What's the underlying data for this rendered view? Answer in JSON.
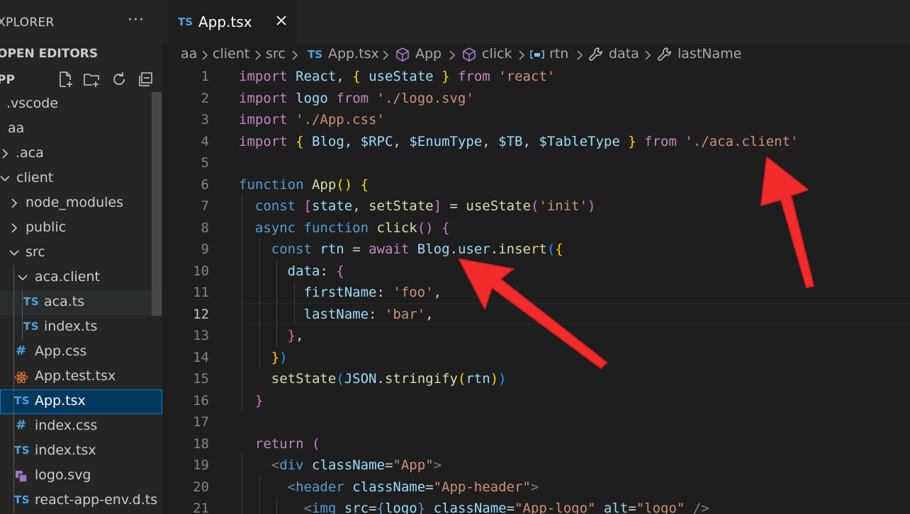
{
  "sidebar": {
    "title": "XPLORER",
    "more": "···",
    "open_editors": "OPEN EDITORS",
    "project": "PP",
    "tree": [
      {
        "label": ".vscode",
        "kind": "folder-collapsed-clipped"
      },
      {
        "label": "aa",
        "kind": "folder-open-clipped"
      },
      {
        "label": ".aca",
        "kind": "folder"
      },
      {
        "label": "client",
        "kind": "folder-open"
      },
      {
        "label": "node_modules",
        "kind": "folder"
      },
      {
        "label": "public",
        "kind": "folder"
      },
      {
        "label": "src",
        "kind": "folder-open"
      },
      {
        "label": "aca.client",
        "kind": "folder-open"
      },
      {
        "label": "aca.ts",
        "kind": "ts",
        "icon_text": "TS"
      },
      {
        "label": "index.ts",
        "kind": "ts",
        "icon_text": "TS"
      },
      {
        "label": "App.css",
        "kind": "css",
        "icon_text": "#"
      },
      {
        "label": "App.test.tsx",
        "kind": "react"
      },
      {
        "label": "App.tsx",
        "kind": "ts",
        "icon_text": "TS"
      },
      {
        "label": "index.css",
        "kind": "css",
        "icon_text": "#"
      },
      {
        "label": "index.tsx",
        "kind": "ts",
        "icon_text": "TS"
      },
      {
        "label": "logo.svg",
        "kind": "svg"
      },
      {
        "label": "react-app-env.d.ts",
        "kind": "ts",
        "icon_text": "TS"
      }
    ]
  },
  "tab": {
    "icon_text": "TS",
    "name": "App.tsx"
  },
  "breadcrumb": {
    "items": [
      "aa",
      "client",
      "src",
      "App.tsx",
      "App",
      "click",
      "rtn",
      "data",
      "lastName"
    ],
    "ts_icon": "TS"
  },
  "editor": {
    "active_line": 12,
    "line_numbers": [
      "1",
      "2",
      "3",
      "4",
      "5",
      "6",
      "7",
      "8",
      "9",
      "10",
      "11",
      "12",
      "13",
      "14",
      "15",
      "16",
      "17",
      "18",
      "19",
      "20",
      "21"
    ]
  },
  "colors": {
    "keyword": "#c586c0",
    "storage": "#569cd6",
    "variable": "#9cdcfe",
    "function": "#dcdcaa",
    "string": "#ce9178",
    "type": "#4ec9b0",
    "annotation_arrow": "#f22c2c"
  }
}
